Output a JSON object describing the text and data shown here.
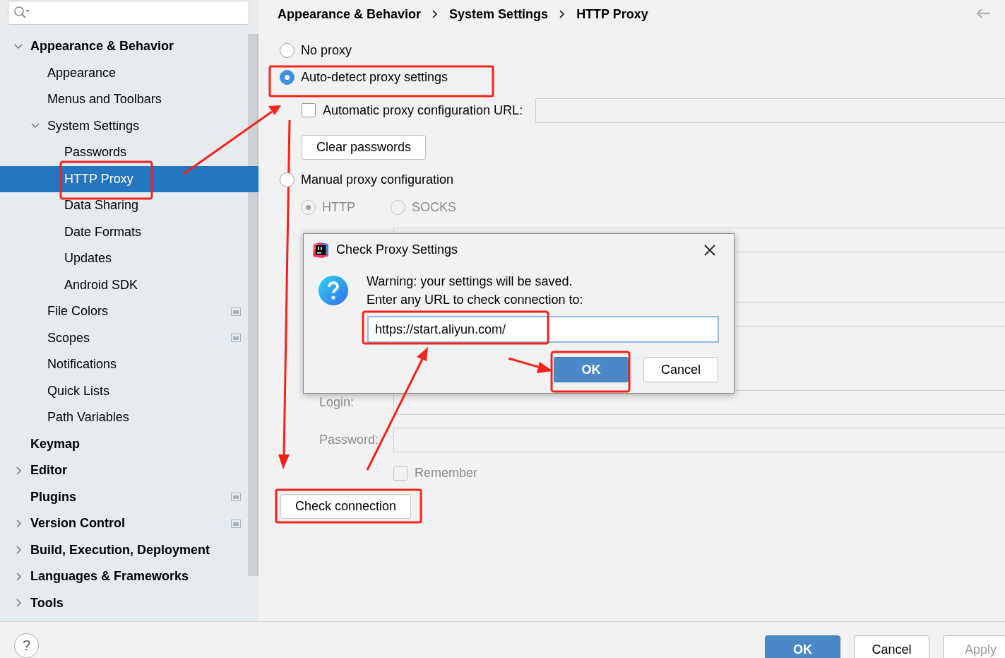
{
  "tree": [
    {
      "label": "Appearance & Behavior",
      "expanded": true,
      "selected": false,
      "children": [
        {
          "label": "Appearance",
          "selected": false
        },
        {
          "label": "Menus and Toolbars",
          "selected": false
        },
        {
          "label": "System Settings",
          "expanded": true,
          "selected": false,
          "children": [
            {
              "label": "Passwords",
              "selected": false
            },
            {
              "label": "HTTP Proxy",
              "selected": true
            },
            {
              "label": "Data Sharing",
              "selected": false
            },
            {
              "label": "Date Formats",
              "selected": false
            },
            {
              "label": "Updates",
              "selected": false
            },
            {
              "label": "Android SDK",
              "selected": false
            }
          ]
        },
        {
          "label": "File Colors",
          "selected": false,
          "scope_icon": true
        },
        {
          "label": "Scopes",
          "selected": false,
          "scope_icon": true
        },
        {
          "label": "Notifications",
          "selected": false
        },
        {
          "label": "Quick Lists",
          "selected": false
        },
        {
          "label": "Path Variables",
          "selected": false
        }
      ]
    },
    {
      "label": "Keymap",
      "selected": false
    },
    {
      "label": "Editor",
      "expanded": false,
      "selected": false
    },
    {
      "label": "Plugins",
      "selected": false,
      "scope_icon": true
    },
    {
      "label": "Version Control",
      "expanded": false,
      "selected": false,
      "scope_icon": true
    },
    {
      "label": "Build, Execution, Deployment",
      "expanded": false,
      "selected": false
    },
    {
      "label": "Languages & Frameworks",
      "expanded": false,
      "selected": false
    },
    {
      "label": "Tools",
      "expanded": false,
      "selected": false
    }
  ],
  "breadcrumb": [
    "Appearance & Behavior",
    "System Settings",
    "HTTP Proxy"
  ],
  "proxy_options": [
    {
      "label": "No proxy",
      "selected": false
    },
    {
      "label": "Auto-detect proxy settings",
      "selected": true
    },
    {
      "label": "Manual proxy configuration",
      "selected": false
    }
  ],
  "auto_detect": {
    "pac_url": {
      "label": "Automatic proxy configuration URL:",
      "checked": false
    },
    "clear_button": "Clear passwords"
  },
  "manual": {
    "disabled": true,
    "protocols": [
      {
        "label": "HTTP",
        "selected": true
      },
      {
        "label": "SOCKS",
        "selected": false
      }
    ],
    "login_label": "Login:",
    "password_label": "Password:",
    "remember": {
      "label": "Remember",
      "checked": false
    }
  },
  "check_button": "Check connection",
  "dialog": {
    "title": "Check Proxy Settings",
    "message": [
      "Warning: your settings will be saved.",
      "Enter any URL to check connection to:"
    ],
    "url": "https://start.aliyun.com/",
    "buttons": [
      {
        "label": "OK",
        "kind": "primary"
      },
      {
        "label": "Cancel",
        "kind": "normal"
      }
    ]
  },
  "footer": {
    "help": "?",
    "buttons": [
      {
        "label": "OK",
        "kind": "primary",
        "disabled": false
      },
      {
        "label": "Cancel",
        "kind": "normal",
        "disabled": false
      },
      {
        "label": "Apply",
        "kind": "normal",
        "disabled": true
      }
    ]
  }
}
